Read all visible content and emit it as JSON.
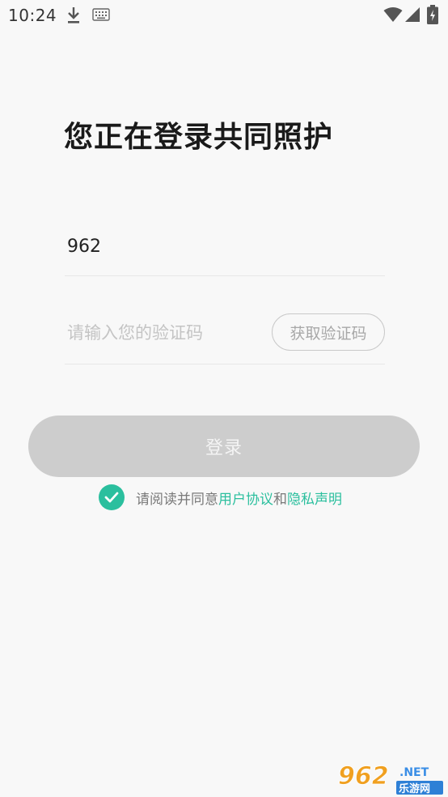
{
  "status_bar": {
    "time": "10:24"
  },
  "title": "您正在登录共同照护",
  "phone": {
    "value": "962"
  },
  "code": {
    "placeholder": "请输入您的验证码",
    "get_code_label": "获取验证码"
  },
  "login_label": "登录",
  "agreement": {
    "prefix": "请阅读并同意",
    "user_agreement": "用户协议",
    "and": "和",
    "privacy": "隐私声明"
  },
  "watermark": {
    "main": "962",
    "net": ".NET",
    "cn": "乐游网"
  },
  "colors": {
    "accent": "#2bbf9e",
    "disabled_button": "#cdcdcd",
    "background": "#f8f8f8"
  }
}
